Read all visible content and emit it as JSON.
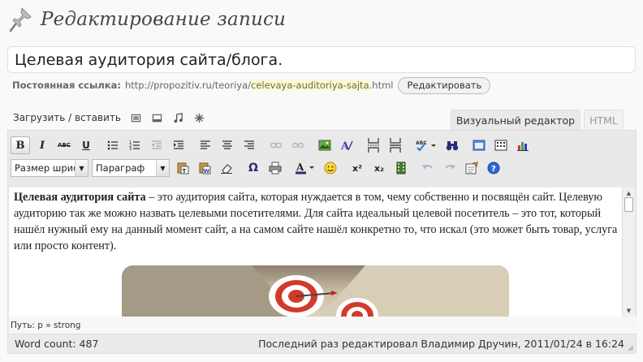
{
  "header": {
    "title": "Редактирование записи",
    "icon": "pushpin-icon"
  },
  "post": {
    "title_value": "Целевая аудитория сайта/блога.",
    "permalink": {
      "label": "Постоянная ссылка:",
      "url_prefix": "http://propozitiv.ru/teoriya/",
      "slug": "celevaya-auditoriya-sajta",
      "url_suffix": ".html",
      "edit_label": "Редактировать"
    }
  },
  "media": {
    "upload_label": "Загрузить / вставить",
    "icons": [
      "image-icon",
      "video-icon",
      "music-note-icon",
      "media-star-icon"
    ]
  },
  "tabs": {
    "visual": "Визуальный редактор",
    "html": "HTML"
  },
  "toolbar": {
    "bold": "B",
    "italic": "I",
    "strike": "ABC",
    "underline": "U",
    "font_size": "Размер шрифт",
    "format": "Параграф",
    "omega": "Ω",
    "sup": "x²",
    "sub": "x₂"
  },
  "colors": {
    "accent_bold": "#333333",
    "slug_highlight": "#fffbcc",
    "text_color_bar": "#2b2b7a"
  },
  "content": {
    "lead_bold": "Целевая аудитория сайта",
    "paragraph": " – это аудитория сайта, которая нуждается в том, чему собственно и посвящён сайт. Целевую аудиторию так же можно назвать целевыми посетителями. Для сайта идеальный целевой посетитель – это тот, который нашёл нужный ему на данный момент сайт, а на самом сайте нашёл конкретно то, что искал (это может быть товар, услуга или просто контент)."
  },
  "path": "Путь: p » strong",
  "status": {
    "word_count": "Word count: 487",
    "last_edited": "Последний раз редактировал Владимир Дручин, 2011/01/24 в 16:24"
  }
}
